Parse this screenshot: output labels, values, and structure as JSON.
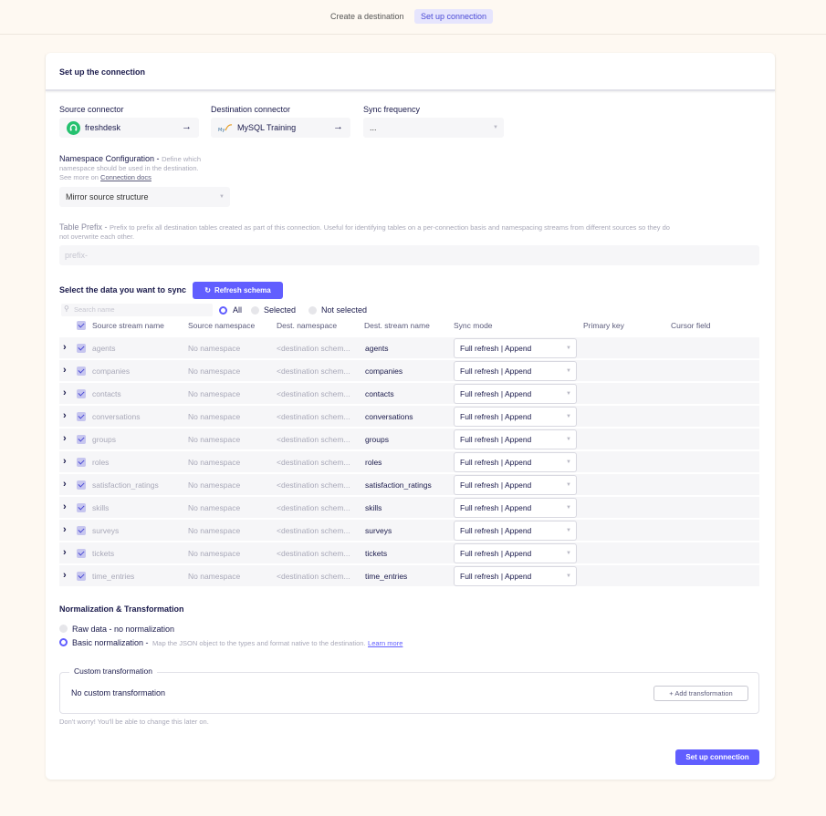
{
  "steps": {
    "step1": "Create a destination",
    "step2": "Set up connection"
  },
  "card_title": "Set up the connection",
  "source": {
    "label": "Source connector",
    "name": "freshdesk"
  },
  "destination": {
    "label": "Destination connector",
    "name": "MySQL Training"
  },
  "sync_frequency": {
    "label": "Sync frequency",
    "value": "..."
  },
  "namespace": {
    "label": "Namespace Configuration - ",
    "desc1": "Define which",
    "desc2": "namespace should be used in the destination.",
    "desc3": "See more on ",
    "link": "Connection docs",
    "value": "Mirror source structure"
  },
  "prefix": {
    "label": "Table Prefix - ",
    "desc": "Prefix to prefix all destination tables created as part of this connection. Useful for identifying tables on a per-connection basis and namespacing streams from different sources so they do",
    "desc2": "not overwrite each other.",
    "placeholder": "prefix-"
  },
  "sync_section": {
    "title": "Select the data you want to sync",
    "refresh_button": "Refresh schema",
    "search_placeholder": "Search name",
    "filters": [
      "All",
      "Selected",
      "Not selected"
    ],
    "selected_filter": "All"
  },
  "table": {
    "headers": [
      "Source stream name",
      "Source namespace",
      "Dest. namespace",
      "Dest. stream name",
      "Sync mode",
      "Primary key",
      "Cursor field"
    ],
    "rows": [
      {
        "name": "agents",
        "ns": "No namespace",
        "dest_ns": "<destination schem...",
        "dest": "agents",
        "mode": "Full refresh | Append"
      },
      {
        "name": "companies",
        "ns": "No namespace",
        "dest_ns": "<destination schem...",
        "dest": "companies",
        "mode": "Full refresh | Append"
      },
      {
        "name": "contacts",
        "ns": "No namespace",
        "dest_ns": "<destination schem...",
        "dest": "contacts",
        "mode": "Full refresh | Append"
      },
      {
        "name": "conversations",
        "ns": "No namespace",
        "dest_ns": "<destination schem...",
        "dest": "conversations",
        "mode": "Full refresh | Append"
      },
      {
        "name": "groups",
        "ns": "No namespace",
        "dest_ns": "<destination schem...",
        "dest": "groups",
        "mode": "Full refresh | Append"
      },
      {
        "name": "roles",
        "ns": "No namespace",
        "dest_ns": "<destination schem...",
        "dest": "roles",
        "mode": "Full refresh | Append"
      },
      {
        "name": "satisfaction_ratings",
        "ns": "No namespace",
        "dest_ns": "<destination schem...",
        "dest": "satisfaction_ratings",
        "mode": "Full refresh | Append"
      },
      {
        "name": "skills",
        "ns": "No namespace",
        "dest_ns": "<destination schem...",
        "dest": "skills",
        "mode": "Full refresh | Append"
      },
      {
        "name": "surveys",
        "ns": "No namespace",
        "dest_ns": "<destination schem...",
        "dest": "surveys",
        "mode": "Full refresh | Append"
      },
      {
        "name": "tickets",
        "ns": "No namespace",
        "dest_ns": "<destination schem...",
        "dest": "tickets",
        "mode": "Full refresh | Append"
      },
      {
        "name": "time_entries",
        "ns": "No namespace",
        "dest_ns": "<destination schem...",
        "dest": "time_entries",
        "mode": "Full refresh | Append"
      }
    ]
  },
  "normalization": {
    "title": "Normalization & Transformation",
    "raw": "Raw data - no normalization",
    "basic": "Basic normalization - ",
    "basic_desc": "Map the JSON object to the types and format native to the destination.",
    "learn_more": "Learn more",
    "selected": "basic"
  },
  "custom_transform": {
    "legend": "Custom transformation",
    "value": "No custom transformation",
    "add_button": "+ Add transformation"
  },
  "footer_note": "Don't worry! You'll be able to change this later on.",
  "submit_button": "Set up connection",
  "colors": {
    "accent": "#615eff",
    "page_bg": "#fef9f2"
  },
  "icons": {
    "source": "freshdesk-logo-icon",
    "destination": "mysql-logo-icon"
  }
}
